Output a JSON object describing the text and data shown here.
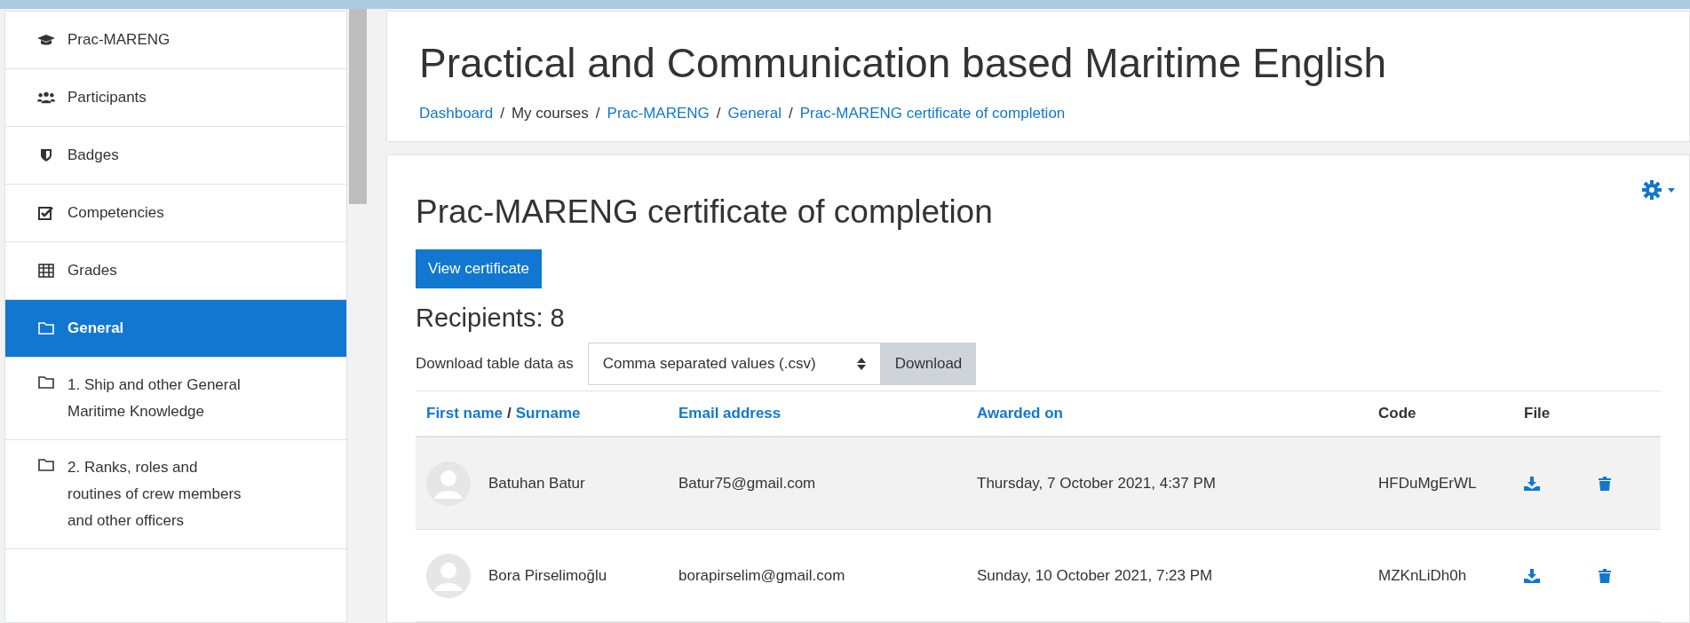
{
  "sidebar": {
    "items": [
      {
        "label": "Prac-MARENG",
        "selected": false
      },
      {
        "label": "Participants",
        "selected": false
      },
      {
        "label": "Badges",
        "selected": false
      },
      {
        "label": "Competencies",
        "selected": false
      },
      {
        "label": "Grades",
        "selected": false
      },
      {
        "label": "General",
        "selected": true
      },
      {
        "label": "1. Ship and other General Maritime Knowledge",
        "selected": false
      },
      {
        "label": "2. Ranks, roles and routines of crew members and other officers",
        "selected": false
      }
    ]
  },
  "header": {
    "title": "Practical and Communication based Maritime English",
    "breadcrumb": [
      {
        "label": "Dashboard",
        "link": true
      },
      {
        "label": "My courses",
        "link": false
      },
      {
        "label": "Prac-MARENG",
        "link": true
      },
      {
        "label": "General",
        "link": true
      },
      {
        "label": "Prac-MARENG certificate of completion",
        "link": true
      }
    ],
    "separator": "/"
  },
  "content": {
    "title": "Prac-MARENG certificate of completion",
    "view_button": "View certificate",
    "recipients": "Recipients: 8",
    "download": {
      "label": "Download table data as",
      "format": "Comma separated values (.csv)",
      "button": "Download"
    },
    "table": {
      "columns": [
        {
          "label": "First name",
          "link": true
        },
        {
          "label": "/",
          "link": false
        },
        {
          "label": "Surname",
          "link": true
        },
        {
          "label": "Email address",
          "link": true
        },
        {
          "label": "Awarded on",
          "link": true
        },
        {
          "label": "Code",
          "link": false
        },
        {
          "label": "File",
          "link": false
        }
      ],
      "rows": [
        {
          "name": "Batuhan Batur",
          "email": "Batur75@gmail.com",
          "awarded": "Thursday, 7 October 2021, 4:37 PM",
          "code": "HFDuMgErWL",
          "highlighted": true
        },
        {
          "name": "Bora Pirselimoğlu",
          "email": "borapirselim@gmail.com",
          "awarded": "Sunday, 10 October 2021, 7:23 PM",
          "code": "MZKnLiDh0h",
          "highlighted": false
        }
      ]
    }
  }
}
